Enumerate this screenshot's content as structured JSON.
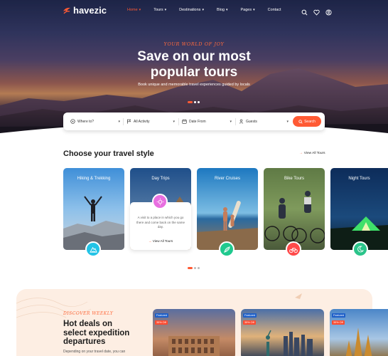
{
  "brand": {
    "name": "havezic",
    "accent": "#ff5a34"
  },
  "nav": {
    "items": [
      {
        "label": "Home",
        "has_dropdown": true,
        "active": true
      },
      {
        "label": "Tours",
        "has_dropdown": true
      },
      {
        "label": "Destinations",
        "has_dropdown": true
      },
      {
        "label": "Blog",
        "has_dropdown": true
      },
      {
        "label": "Pages",
        "has_dropdown": true
      },
      {
        "label": "Contact",
        "has_dropdown": false
      }
    ],
    "icons": [
      "search-icon",
      "heart-icon",
      "user-icon"
    ]
  },
  "hero": {
    "subtitle": "YOUR WORLD OF JOY",
    "title_line1": "Save on our most",
    "title_line2": "popular tours",
    "description": "Book unique and memorable travel experiences guided by locals"
  },
  "search": {
    "where": "Where to?",
    "activity": "All Activity",
    "date": "Date From",
    "guests": "Guests",
    "button": "Search"
  },
  "travel_style": {
    "title": "Choose your travel style",
    "view_all": "View All Tours",
    "cards": [
      {
        "title": "Hiking & Trekking",
        "icon": "hiking-icon",
        "color": "#22c3e6"
      },
      {
        "title": "Day Trips",
        "icon": "sun-icon",
        "color": "#e86fe0",
        "description": "A visit to a place in which you go there and come back on the same day.",
        "link": "View All Tours"
      },
      {
        "title": "River Cruises",
        "icon": "surf-icon",
        "color": "#1fc98e"
      },
      {
        "title": "Bike Tours",
        "icon": "bike-icon",
        "color": "#ff4a4a"
      },
      {
        "title": "Night Tours",
        "icon": "moon-icon",
        "color": "#2bc48a"
      }
    ]
  },
  "deals": {
    "subtitle": "DISCOVER WEEKLY",
    "title_line1": "Hot deals on",
    "title_line2": "select expedition",
    "title_line3": "departures",
    "description": "Depending on your travel date, you can",
    "cards": [
      {
        "tag": "Featured",
        "discount": "35% Off"
      },
      {
        "tag": "Featured",
        "discount": "35% Off"
      },
      {
        "tag": "Featured",
        "discount": "35% Off"
      }
    ]
  }
}
